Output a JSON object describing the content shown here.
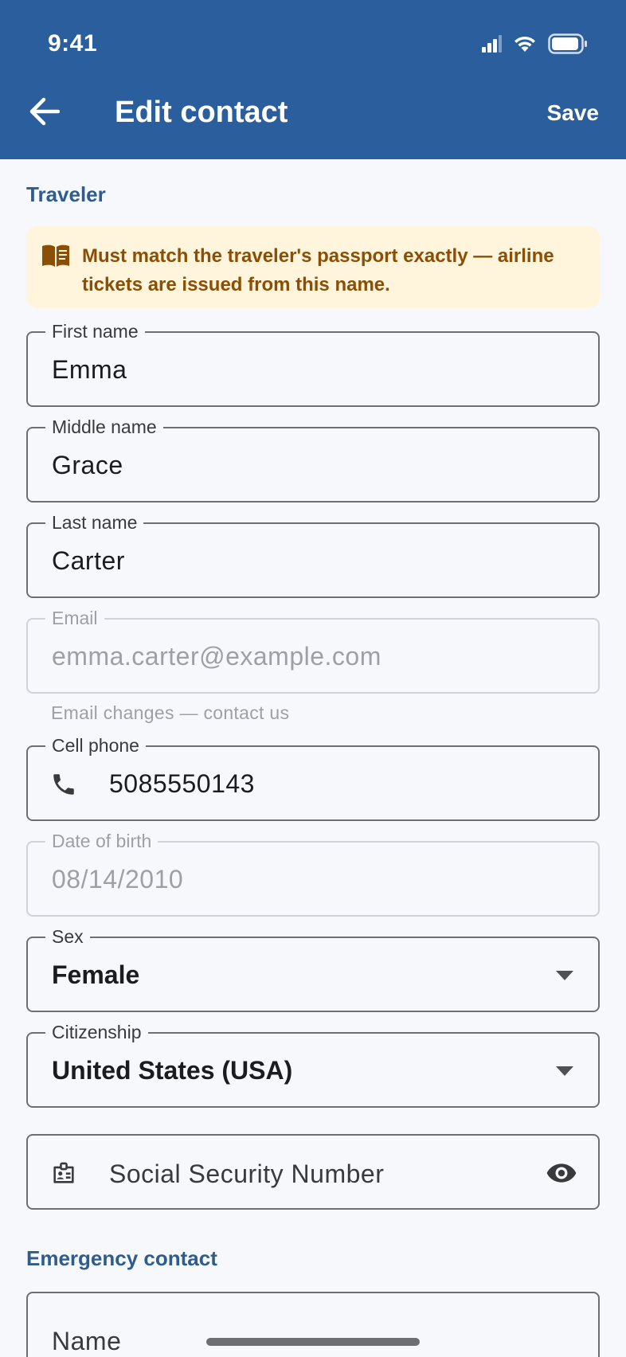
{
  "status_bar": {
    "time": "9:41"
  },
  "app_bar": {
    "title": "Edit contact",
    "save_label": "Save"
  },
  "traveler": {
    "section_title": "Traveler",
    "notice": "Must match the traveler's passport exactly — airline tickets are issued from this name.",
    "first_name": {
      "label": "First name",
      "value": "Emma"
    },
    "middle_name": {
      "label": "Middle name",
      "value": "Grace"
    },
    "last_name": {
      "label": "Last name",
      "value": "Carter"
    },
    "email": {
      "label": "Email",
      "value": "emma.carter@example.com",
      "helper": "Email changes — contact us"
    },
    "cell_phone": {
      "label": "Cell phone",
      "value": "5085550143"
    },
    "date_of_birth": {
      "label": "Date of birth",
      "value": "08/14/2010"
    },
    "sex": {
      "label": "Sex",
      "value": "Female"
    },
    "citizenship": {
      "label": "Citizenship",
      "value": "United States (USA)"
    },
    "ssn": {
      "placeholder": "Social Security Number"
    }
  },
  "emergency_contact": {
    "section_title": "Emergency contact",
    "name": {
      "placeholder": "Name"
    }
  },
  "colors": {
    "app_bar": "#2a5e9c",
    "section_title": "#2e5c8e",
    "notice_background": "#fff4dc",
    "notice_text": "#8a4f04"
  },
  "icons": [
    "back-arrow-icon",
    "signal-icon",
    "wifi-icon",
    "battery-icon",
    "book-icon",
    "phone-icon",
    "id-card-icon",
    "eye-icon",
    "dropdown-arrow-icon"
  ]
}
